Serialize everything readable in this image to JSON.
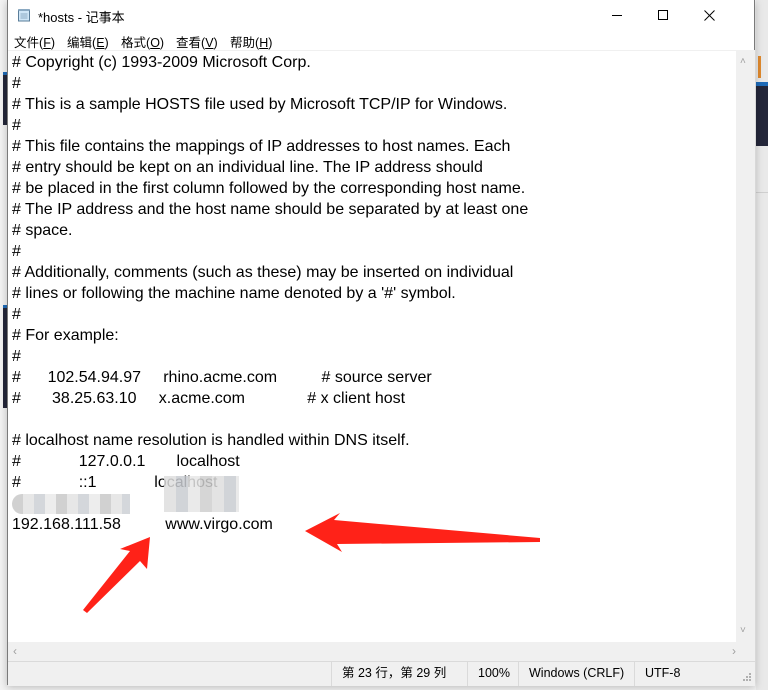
{
  "window": {
    "title": "*hosts - 记事本",
    "controls": {
      "minimize": "minimize",
      "maximize": "maximize",
      "close": "close"
    }
  },
  "menu": [
    {
      "label": "文件",
      "accel": "(F)",
      "key": "F"
    },
    {
      "label": "编辑",
      "accel": "(E)",
      "key": "E"
    },
    {
      "label": "格式",
      "accel": "(O)",
      "key": "O"
    },
    {
      "label": "查看",
      "accel": "(V)",
      "key": "V"
    },
    {
      "label": "帮助",
      "accel": "(H)",
      "key": "H"
    }
  ],
  "editor": {
    "lines": [
      "# Copyright (c) 1993-2009 Microsoft Corp.",
      "#",
      "# This is a sample HOSTS file used by Microsoft TCP/IP for Windows.",
      "#",
      "# This file contains the mappings of IP addresses to host names. Each",
      "# entry should be kept on an individual line. The IP address should",
      "# be placed in the first column followed by the corresponding host name.",
      "# The IP address and the host name should be separated by at least one",
      "# space.",
      "#",
      "# Additionally, comments (such as these) may be inserted on individual",
      "# lines or following the machine name denoted by a '#' symbol.",
      "#",
      "# For example:",
      "#",
      "#      102.54.94.97     rhino.acme.com          # source server",
      "#       38.25.63.10     x.acme.com              # x client host",
      "",
      "# localhost name resolution is handled within DNS itself.",
      "#             127.0.0.1       localhost",
      "#             ::1             localhost",
      "",
      "192.168.111.58          www.virgo.com"
    ],
    "redacted_line_index": 21
  },
  "scrollbars": {
    "vertical": {
      "up": "scroll-up",
      "down": "scroll-down"
    },
    "horizontal": {
      "left": "scroll-left",
      "right": "scroll-right"
    }
  },
  "statusbar": {
    "position": "第 23 行，第 29 列",
    "zoom": "100%",
    "line_ending": "Windows (CRLF)",
    "encoding": "UTF-8"
  },
  "annotations": {
    "arrow_color": "#ff2218",
    "arrows": [
      {
        "points_to": "www.virgo.com",
        "direction": "left"
      },
      {
        "points_to": "gap between IP and hostname",
        "direction": "up-right"
      }
    ]
  }
}
